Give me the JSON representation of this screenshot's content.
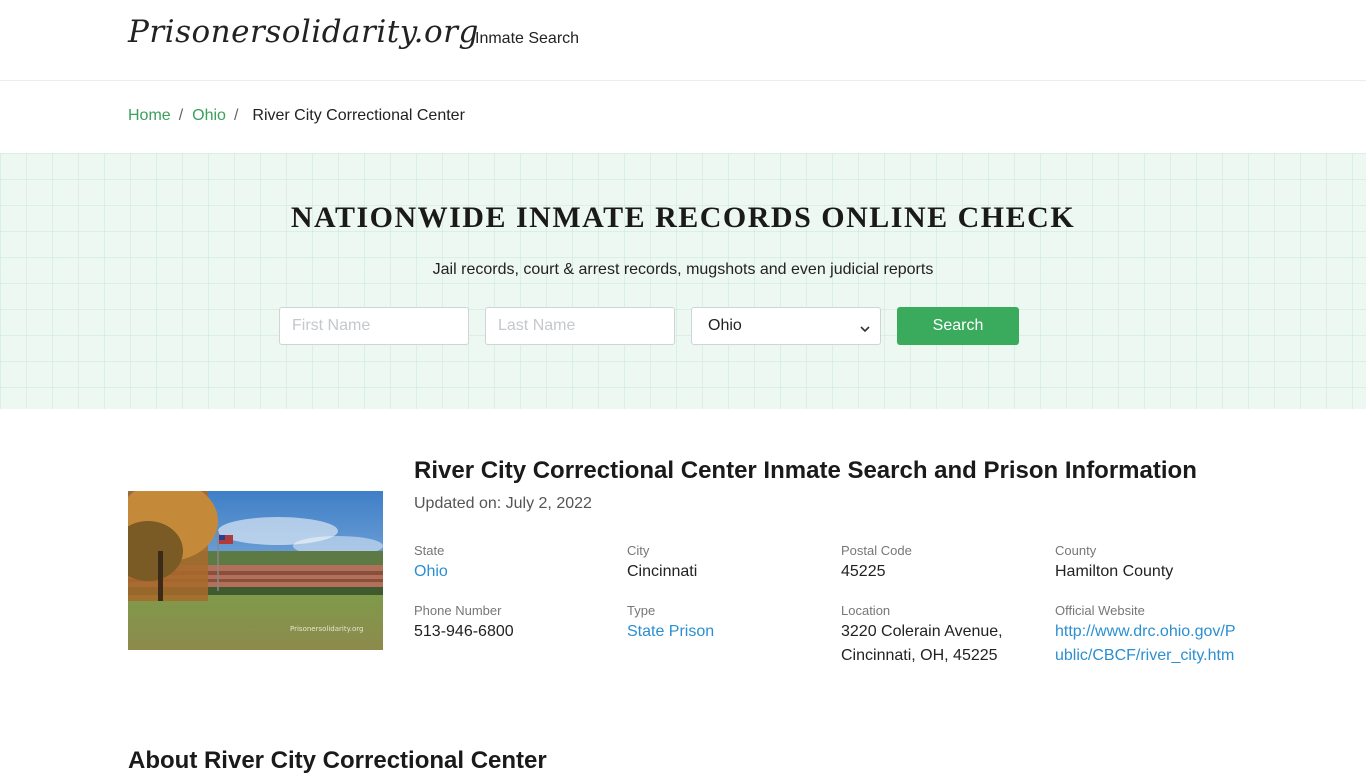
{
  "header": {
    "logo": "Prisonersolidarity.org",
    "nav_inmate_search": "Inmate Search"
  },
  "breadcrumb": {
    "home": "Home",
    "state": "Ohio",
    "current": "River City Correctional Center"
  },
  "hero": {
    "title": "NATIONWIDE INMATE RECORDS ONLINE CHECK",
    "subtitle": "Jail records, court & arrest records, mugshots and even judicial reports",
    "first_name_placeholder": "First Name",
    "last_name_placeholder": "Last Name",
    "state_selected": "Ohio",
    "search_label": "Search"
  },
  "facility": {
    "title": "River City Correctional Center Inmate Search and Prison Information",
    "updated": "Updated on: July 2, 2022",
    "photo_watermark": "Prisonersolidarity.org",
    "state_label": "State",
    "state_value": "Ohio",
    "city_label": "City",
    "city_value": "Cincinnati",
    "postal_label": "Postal Code",
    "postal_value": "45225",
    "county_label": "County",
    "county_value": "Hamilton County",
    "phone_label": "Phone Number",
    "phone_value": "513-946-6800",
    "type_label": "Type",
    "type_value": "State Prison",
    "location_label": "Location",
    "location_line1": "3220 Colerain Avenue,",
    "location_line2": "Cincinnati, OH, 45225",
    "website_label": "Official Website",
    "website_value": "http://www.drc.ohio.gov/Public/CBCF/river_city.htm"
  },
  "about_heading": "About River City Correctional Center",
  "colors": {
    "accent_green": "#3aab5c",
    "link_blue": "#2b8fd1",
    "hero_bg": "#eef8f2"
  }
}
